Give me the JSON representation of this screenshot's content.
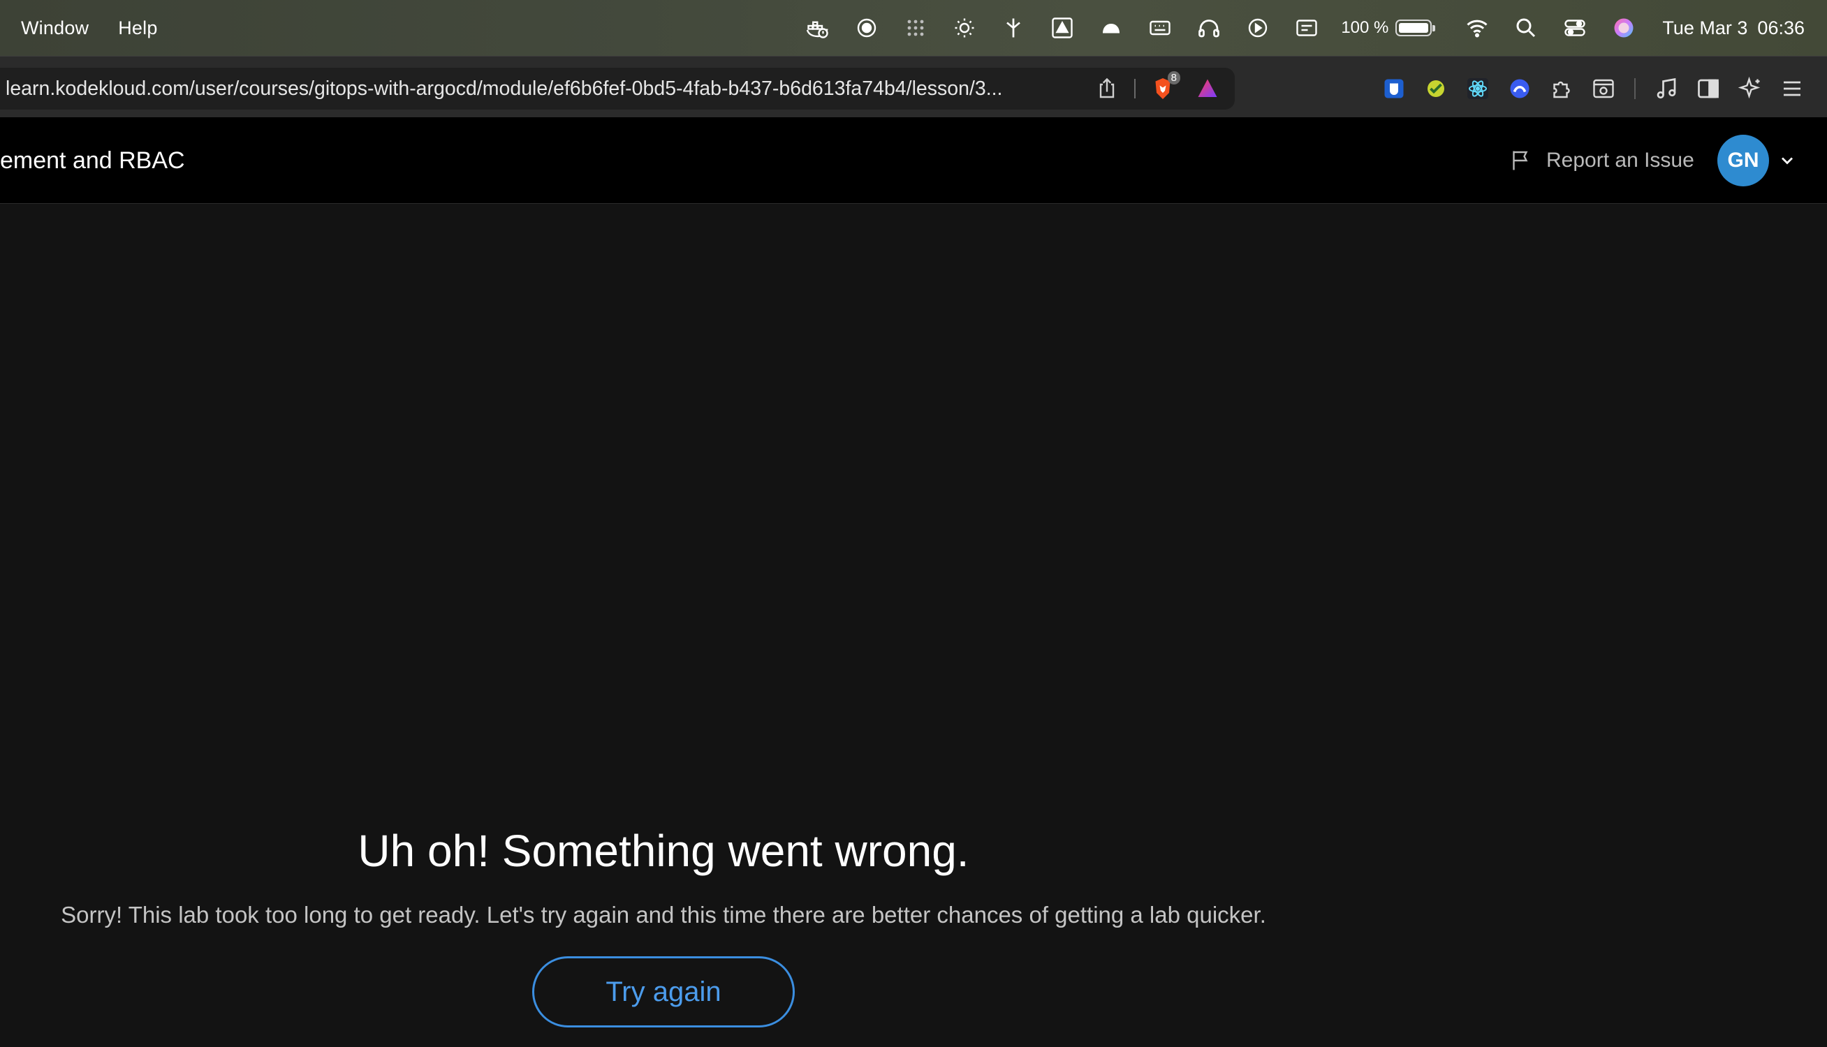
{
  "menubar": {
    "menus": [
      "Window",
      "Help"
    ],
    "icons": [
      "docker-icon",
      "screen-record-icon",
      "grid-dots-icon",
      "brightness-icon",
      "cursor-split-icon",
      "google-drive-icon",
      "cloud-icon",
      "keyboard-icon",
      "headphones-icon",
      "play-icon",
      "caption-icon"
    ],
    "battery_percent": "100 %",
    "battery_level": 1.0,
    "date": "Tue Mar 3",
    "time": "06:36"
  },
  "browser": {
    "url": "learn.kodekloud.com/user/courses/gitops-with-argocd/module/ef6b6fef-0bd5-4fab-b437-b6d613fa74b4/lesson/3...",
    "brave_shield_count": "8",
    "extensions": [
      "bitwarden-icon",
      "qa-extension-icon",
      "react-devtools-icon",
      "arc-extension-icon",
      "extensions-puzzle-icon",
      "reader-icon",
      "music-icon",
      "sidebar-icon",
      "leo-ai-icon",
      "menu-icon"
    ]
  },
  "header": {
    "lesson_title": "ement and RBAC",
    "report_label": "Report an Issue",
    "avatar_initials": "GN"
  },
  "error": {
    "title": "Uh oh! Something went wrong.",
    "message": "Sorry! This lab took too long to get ready. Let's try again and this time there are better chances of getting a lab quicker.",
    "button_label": "Try again"
  },
  "colors": {
    "page_bg": "#131313",
    "header_bg": "#000000",
    "accent": "#3b8ee0",
    "avatar_bg": "#2e8bd0"
  }
}
